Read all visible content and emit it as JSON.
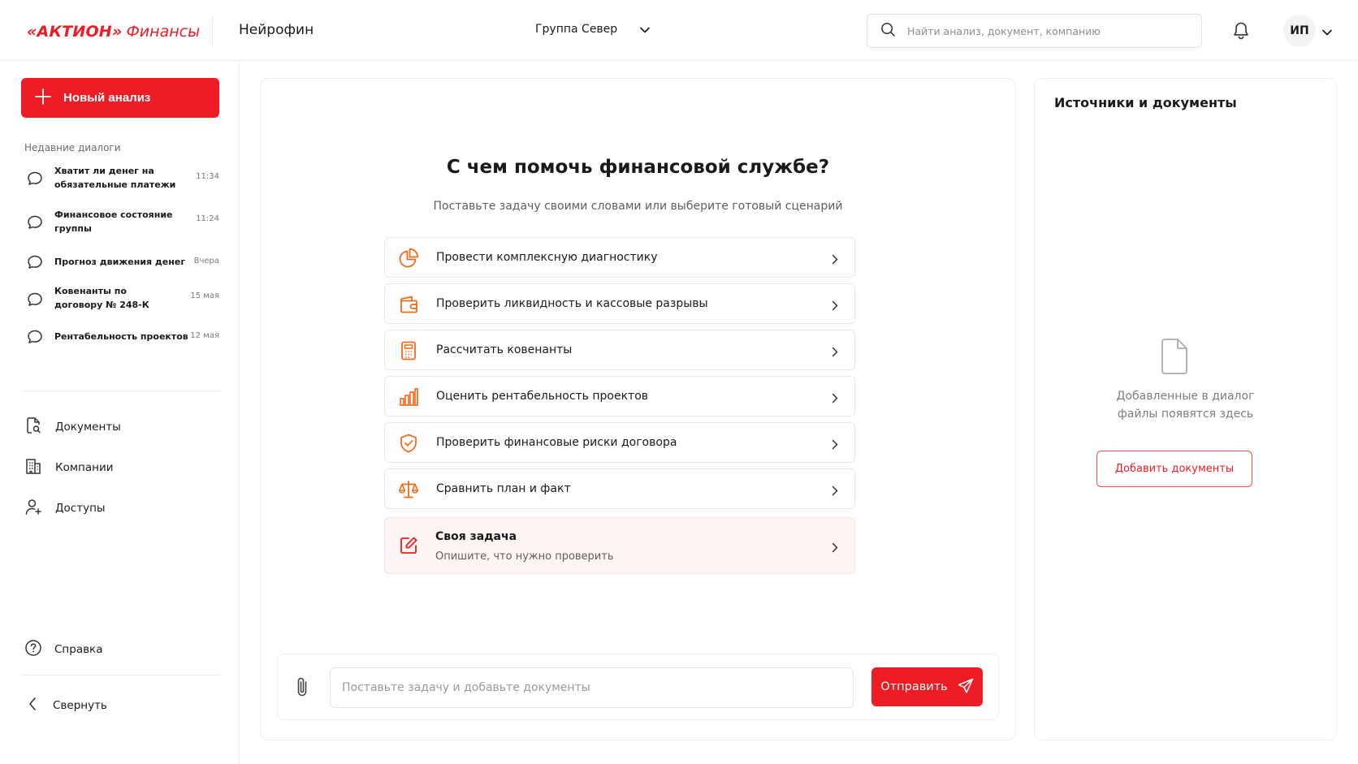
{
  "header": {
    "brand": "«АКТИОН»",
    "brand_sub": "Финансы",
    "product": "Нейрофин",
    "group": "Группа Север",
    "search_placeholder": "Найти анализ, документ, компанию",
    "user_initials": "ИП"
  },
  "sidebar": {
    "new_analysis": "Новый анализ",
    "recent_title": "Недавние диалоги",
    "dialogs": [
      {
        "title": "Хватит ли денег на обязательные платежи",
        "time": "11:34"
      },
      {
        "title": "Финансовое состояние группы",
        "time": "11:24"
      },
      {
        "title": "Прогноз движения денег",
        "time": "Вчера"
      },
      {
        "title": "Ковенанты по договору № 248-К",
        "time": "15 мая"
      },
      {
        "title": "Рентабельность проектов",
        "time": "12 мая"
      }
    ],
    "nav": {
      "documents": "Документы",
      "companies": "Компании",
      "access": "Доступы"
    },
    "help": "Справка",
    "collapse": "Свернуть"
  },
  "center": {
    "title": "С чем помочь финансовой службе?",
    "subtitle": "Поставьте задачу своими словами или выберите готовый сценарий",
    "scenarios": [
      "Провести комплексную диагностику",
      "Проверить ликвидность и кассовые разрывы",
      "Рассчитать ковенанты",
      "Оценить рентабельность проектов",
      "Проверить финансовые риски договора",
      "Сравнить план и факт"
    ],
    "custom": {
      "title": "Своя задача",
      "subtitle": "Опишите, что нужно проверить"
    },
    "composer": {
      "placeholder": "Поставьте задачу и добавьте документы",
      "send": "Отправить"
    }
  },
  "right": {
    "title": "Источники и документы",
    "empty_line1": "Добавленные в диалог",
    "empty_line2": "файлы появятся здесь",
    "add_button": "Добавить документы"
  },
  "colors": {
    "accent": "#ee1c25",
    "icon_orange": "#f26b1d"
  }
}
